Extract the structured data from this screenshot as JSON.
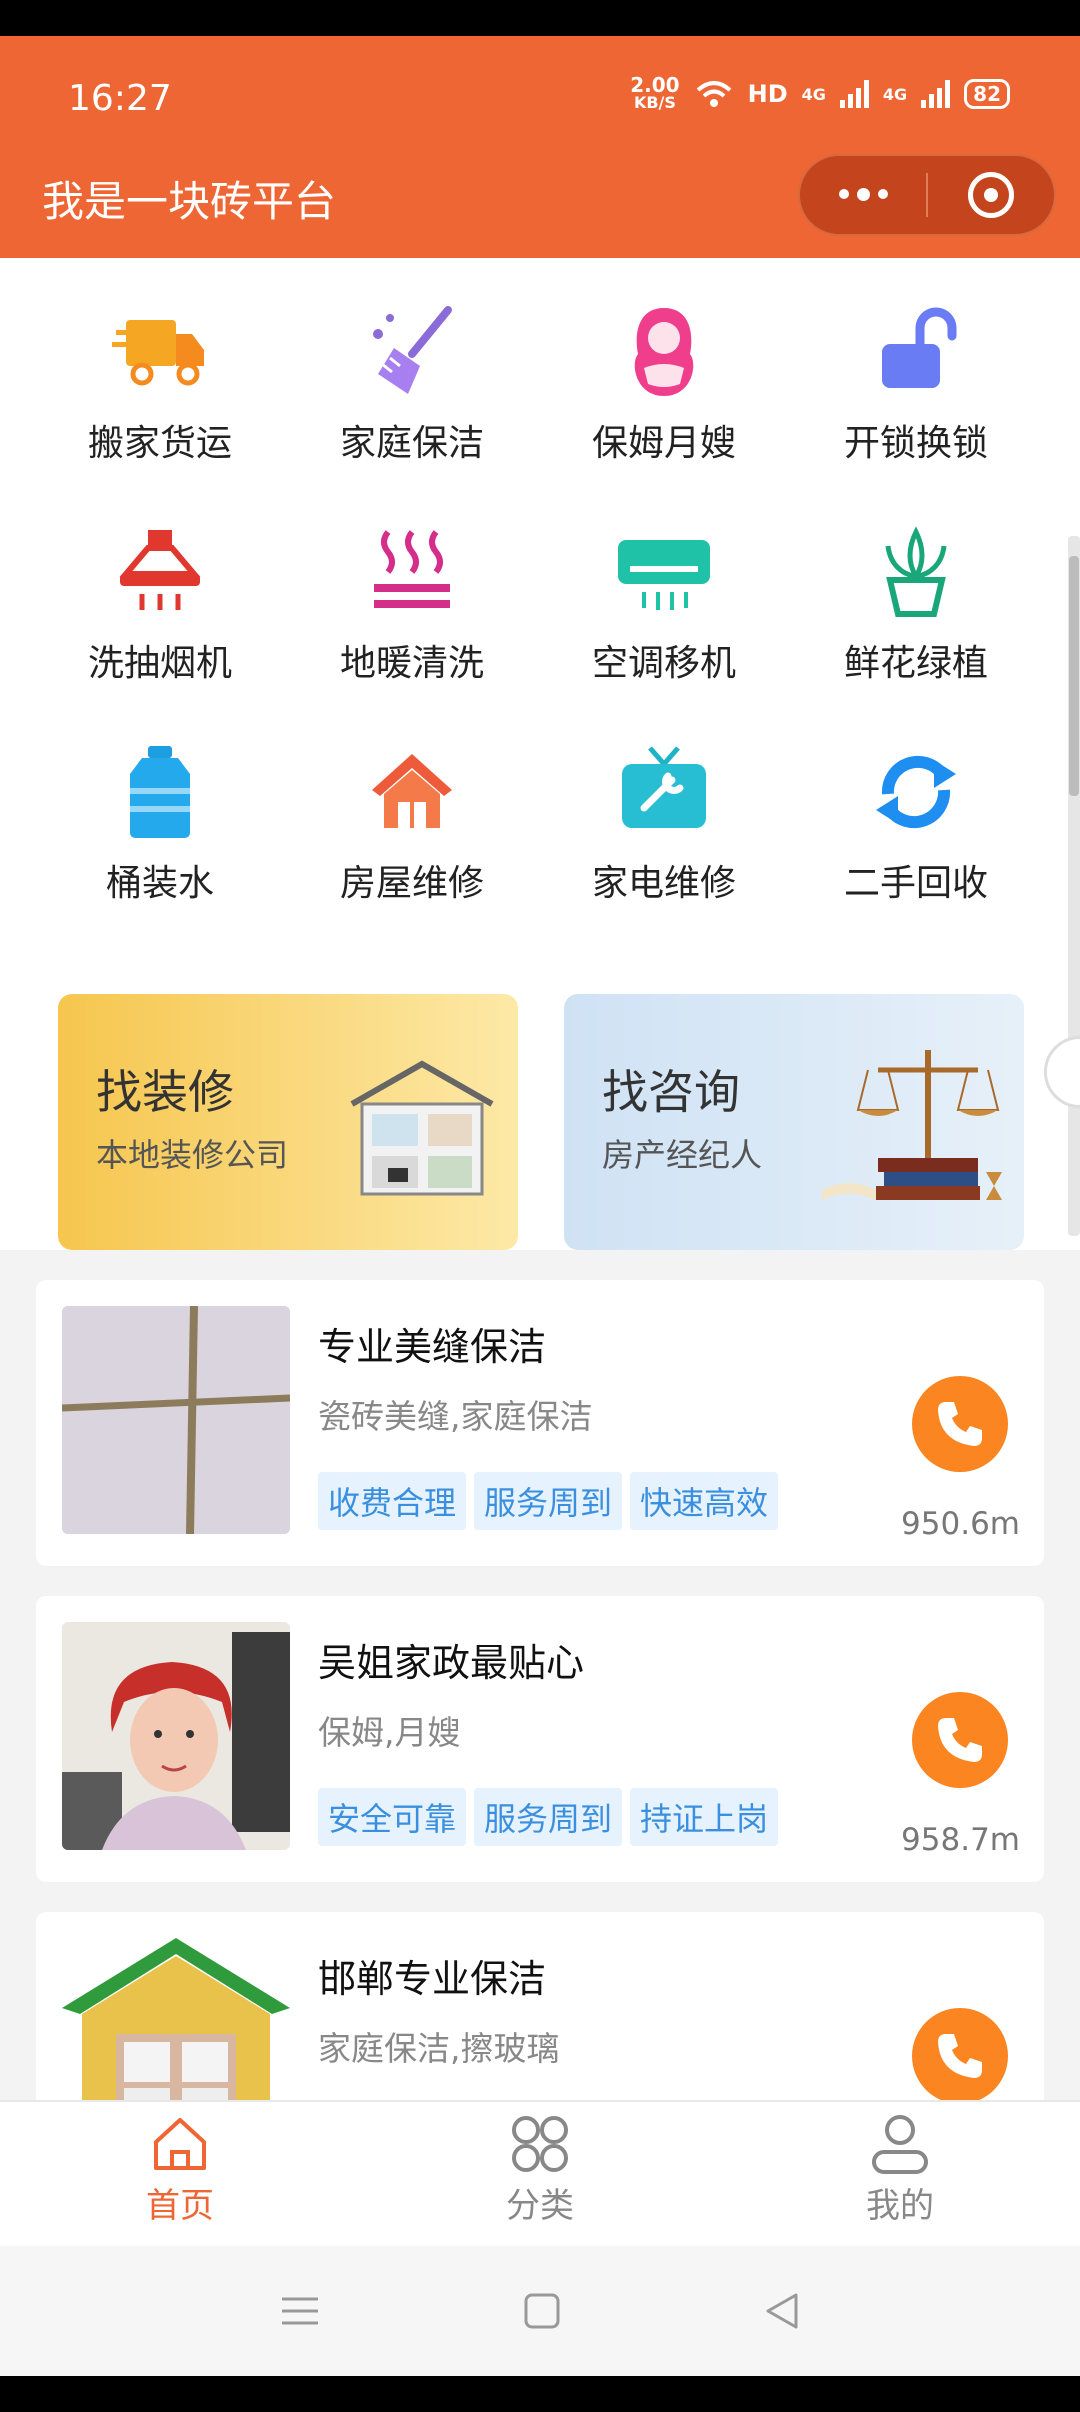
{
  "status": {
    "time": "16:27",
    "net_speed_value": "2.00",
    "net_speed_unit": "KB/S",
    "hd": "HD",
    "net1": "4G",
    "net2": "4G",
    "battery": "82"
  },
  "app": {
    "title": "我是一块砖平台"
  },
  "services": [
    {
      "label": "搬家货运",
      "icon": "moving-truck-icon"
    },
    {
      "label": "家庭保洁",
      "icon": "broom-icon"
    },
    {
      "label": "保姆月嫂",
      "icon": "nanny-icon"
    },
    {
      "label": "开锁换锁",
      "icon": "padlock-icon"
    },
    {
      "label": "洗抽烟机",
      "icon": "range-hood-icon"
    },
    {
      "label": "地暖清洗",
      "icon": "floor-heating-icon"
    },
    {
      "label": "空调移机",
      "icon": "air-conditioner-icon"
    },
    {
      "label": "鲜花绿植",
      "icon": "potted-plant-icon"
    },
    {
      "label": "桶装水",
      "icon": "water-bottle-icon"
    },
    {
      "label": "房屋维修",
      "icon": "house-icon"
    },
    {
      "label": "家电维修",
      "icon": "tv-repair-icon"
    },
    {
      "label": "二手回收",
      "icon": "recycle-icon"
    }
  ],
  "banners": [
    {
      "title": "找装修",
      "subtitle": "本地装修公司"
    },
    {
      "title": "找咨询",
      "subtitle": "房产经纪人"
    }
  ],
  "listings": [
    {
      "name": "专业美缝保洁",
      "desc": "瓷砖美缝,家庭保洁",
      "tags": [
        "收费合理",
        "服务周到",
        "快速高效"
      ],
      "distance": "950.6m"
    },
    {
      "name": "吴姐家政最贴心",
      "desc": "保姆,月嫂",
      "tags": [
        "安全可靠",
        "服务周到",
        "持证上岗"
      ],
      "distance": "958.7m"
    },
    {
      "name": "邯郸专业保洁",
      "desc": "家庭保洁,擦玻璃",
      "tags": [],
      "distance": ""
    }
  ],
  "tabs": [
    {
      "label": "首页",
      "icon": "home-icon",
      "active": true
    },
    {
      "label": "分类",
      "icon": "grid-icon",
      "active": false
    },
    {
      "label": "我的",
      "icon": "user-icon",
      "active": false
    }
  ],
  "colors": {
    "brand": "#ee6634",
    "call_button": "#fb8520",
    "tag_text": "#3a8fde",
    "tag_bg": "#e6f2fd"
  }
}
